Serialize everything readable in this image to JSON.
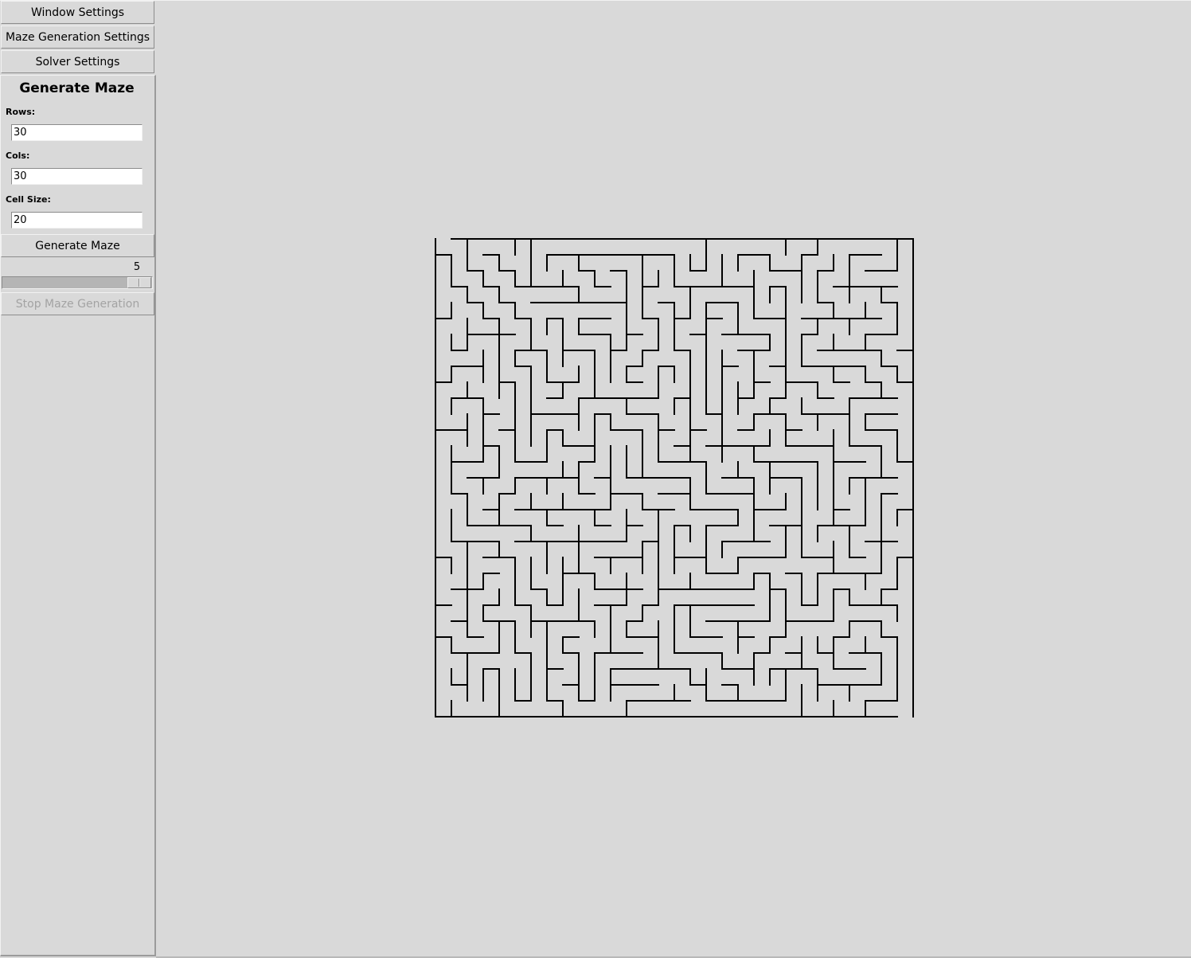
{
  "menu": {
    "window_settings": "Window Settings",
    "maze_generation_settings": "Maze Generation Settings",
    "solver_settings": "Solver Settings"
  },
  "generate": {
    "heading": "Generate Maze",
    "rows_label": "Rows:",
    "rows_value": "30",
    "cols_label": "Cols:",
    "cols_value": "30",
    "cell_size_label": "Cell Size:",
    "cell_size_value": "20",
    "generate_button": "Generate Maze",
    "speed_value": "5",
    "stop_button": "Stop Maze Generation",
    "stop_enabled": false
  },
  "maze": {
    "rows": 30,
    "cols": 30,
    "cell_size": 20,
    "wall_color": "#000000",
    "background_color": "#d9d9d9",
    "entrance": "top-left",
    "exit": "bottom-right"
  }
}
